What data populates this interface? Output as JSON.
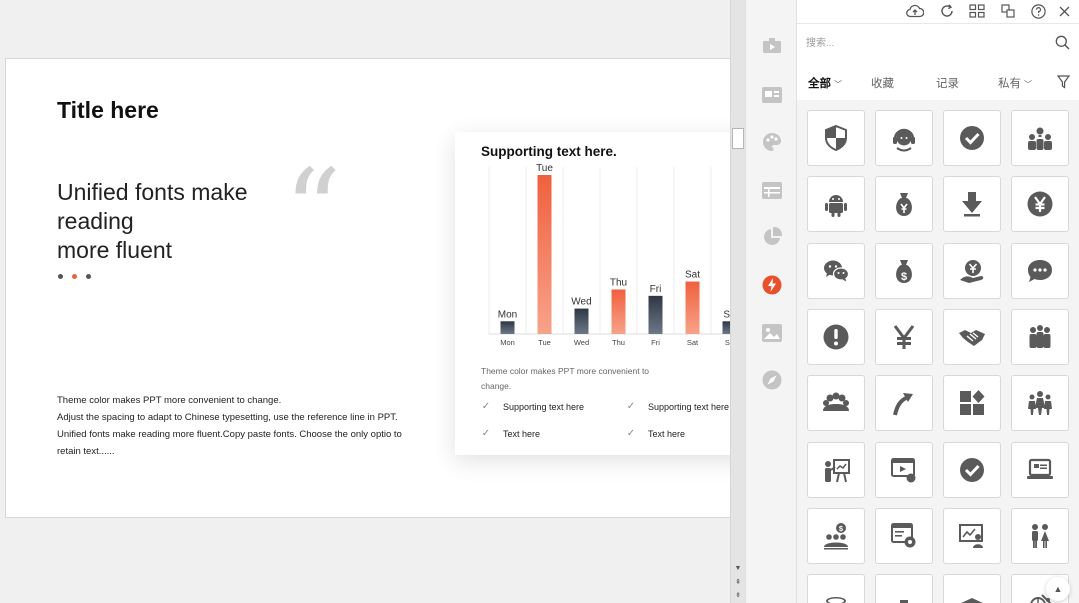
{
  "slide": {
    "title": "Title here",
    "quote_lines": [
      "Unified fonts make",
      "reading",
      "more fluent"
    ],
    "quote_mark": "“",
    "body_lines": [
      "Theme  color makes PPT more convenient to change.",
      "Adjust the spacing to adapt to Chinese typesetting, use the reference line in PPT.",
      "Unified fonts make reading more fluent.Copy paste fonts. Choose the only optio to",
      "retain text......"
    ],
    "card": {
      "title": "Supporting text here.",
      "caption": "Theme color makes PPT more convenient to change.",
      "checks": [
        "Supporting text here",
        "Supporting text here",
        "Text here",
        "Text here"
      ]
    }
  },
  "chart_data": {
    "type": "bar",
    "categories": [
      "Mon",
      "Tue",
      "Wed",
      "Thu",
      "Fri",
      "Sat",
      "Su"
    ],
    "values": [
      8,
      100,
      16,
      28,
      24,
      33,
      8
    ],
    "data_labels": [
      "Mon",
      "Tue",
      "Wed",
      "Thu",
      "Fri",
      "Sat",
      "Su"
    ],
    "colors": [
      "#3d4652",
      "#f0714e",
      "#3d4652",
      "#f0714e",
      "#3d4652",
      "#f0714e",
      "#3d4652"
    ],
    "title": "Supporting text here.",
    "xlabel": "",
    "ylabel": "",
    "ylim": [
      0,
      100
    ],
    "grid": true
  },
  "panel": {
    "search_placeholder": "搜索...",
    "tabs": [
      {
        "label": "全部",
        "dropdown": true,
        "active": true
      },
      {
        "label": "收藏",
        "dropdown": false,
        "active": false
      },
      {
        "label": "记录",
        "dropdown": false,
        "active": false
      },
      {
        "label": "私有",
        "dropdown": true,
        "active": false
      }
    ],
    "top_icons": [
      "cloud-upload-icon",
      "refresh-icon",
      "grid-layout-icon",
      "transform-icon",
      "help-icon",
      "close-icon"
    ],
    "rail_icons": [
      "presentation-icon",
      "image-text-icon",
      "palette-icon",
      "table-icon",
      "pie-chart-icon",
      "lightning-icon",
      "picture-icon",
      "compass-icon"
    ],
    "active_rail": "lightning-icon",
    "icons": [
      "shield-icon",
      "customer-service-icon",
      "checkmark-icon",
      "team-idea-icon",
      "android-icon",
      "yen-moneybag-icon",
      "download-arrow-icon",
      "yen-coin-icon",
      "wechat-icon",
      "dollar-moneybag-icon",
      "hand-yen-icon",
      "chat-bubble-icon",
      "exclamation-icon",
      "yen-sign-icon",
      "handshake-icon",
      "group-icon",
      "crowd-icon",
      "growth-arrow-icon",
      "apps-grid-icon",
      "team-people-icon",
      "presenter-icon",
      "video-click-icon",
      "checkmark-icon",
      "laptop-icon",
      "dollar-team-icon",
      "web-settings-icon",
      "screen-presenter-icon",
      "couple-icon",
      "coin-stack-icon",
      "org-chart-icon",
      "graduation-cap-icon",
      "globe-icon"
    ]
  },
  "colors": {
    "accent": "#e8643c",
    "dark_bar": "#3d4652",
    "icon": "#555555"
  }
}
